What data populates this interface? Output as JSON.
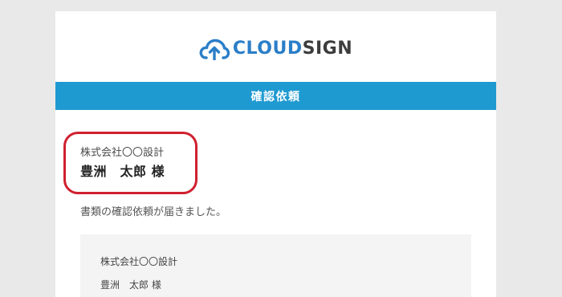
{
  "logo": {
    "brand_part1": "CLOUD",
    "brand_part2": "SIGN",
    "icon": "cloud-upload-icon",
    "colors": {
      "cloud": "#2b7ec8",
      "sign": "#3d3d3d"
    }
  },
  "header": {
    "title": "確認依頼",
    "background": "#1f9ad1"
  },
  "recipient": {
    "company": "株式会社〇〇設計",
    "name": "豊洲　太郎 様",
    "highlight_color": "#d0202f"
  },
  "message": {
    "text": "書類の確認依頼が届きました。"
  },
  "details": {
    "company": "株式会社〇〇設計",
    "name": "豊洲　太郎 様"
  }
}
